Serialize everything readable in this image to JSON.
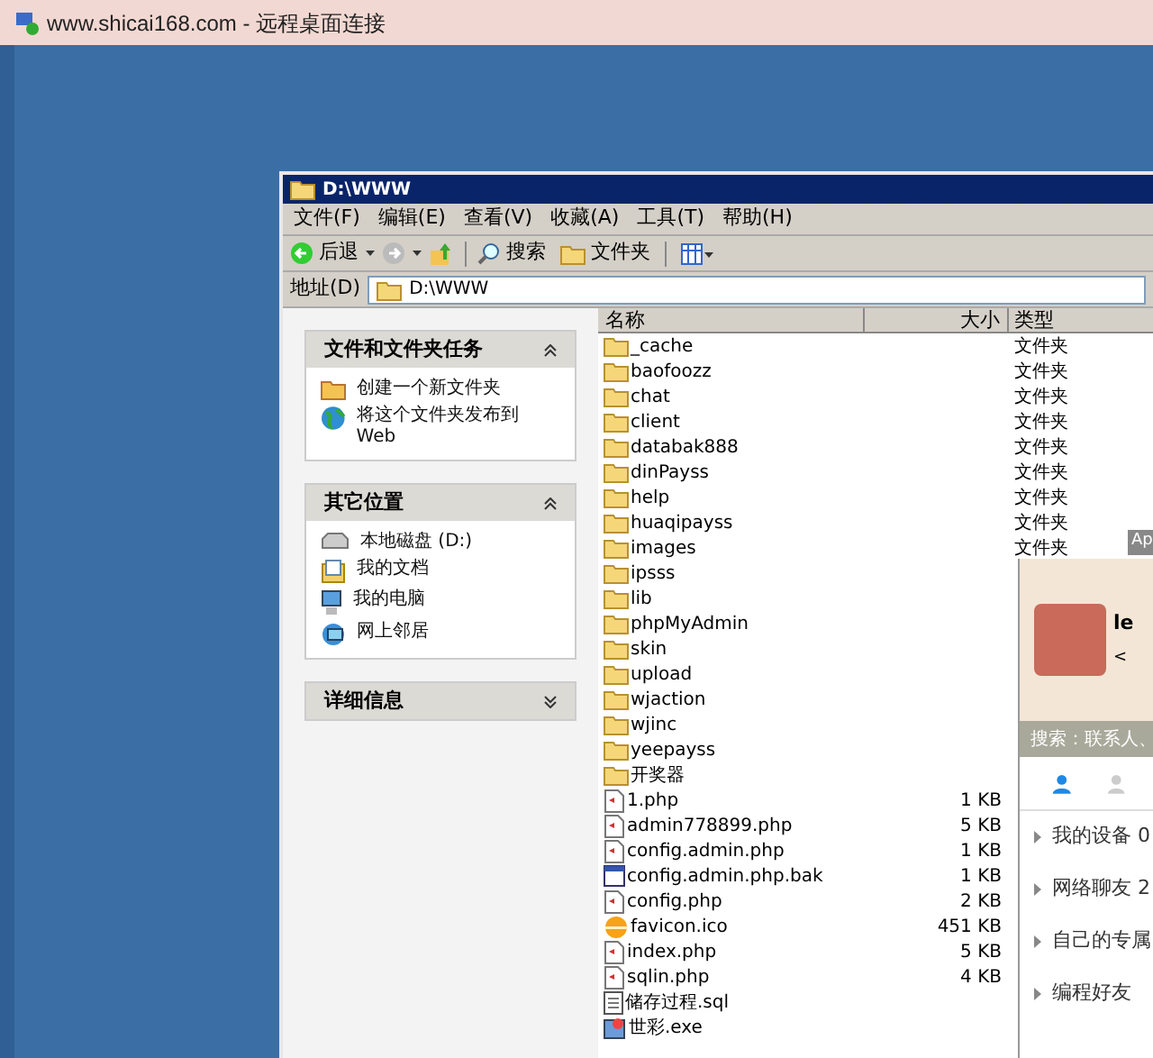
{
  "rdp_title": "www.shicai168.com - 远程桌面连接",
  "window": {
    "title": "D:\\WWW"
  },
  "menu": [
    "文件(F)",
    "编辑(E)",
    "查看(V)",
    "收藏(A)",
    "工具(T)",
    "帮助(H)"
  ],
  "toolbar": {
    "back": "后退",
    "search": "搜索",
    "folders": "文件夹"
  },
  "address": {
    "label": "地址(D)",
    "value": "D:\\WWW"
  },
  "panels": [
    {
      "title": "文件和文件夹任务",
      "expanded": true,
      "items": [
        {
          "kind": "new-folder",
          "label": "创建一个新文件夹"
        },
        {
          "kind": "globe",
          "label": "将这个文件夹发布到 Web"
        }
      ]
    },
    {
      "title": "其它位置",
      "expanded": true,
      "items": [
        {
          "kind": "drive",
          "label": "本地磁盘 (D:)"
        },
        {
          "kind": "documents",
          "label": "我的文档"
        },
        {
          "kind": "computer",
          "label": "我的电脑"
        },
        {
          "kind": "network",
          "label": "网上邻居"
        }
      ]
    },
    {
      "title": "详细信息",
      "expanded": false
    }
  ],
  "table": {
    "columns": [
      "名称",
      "大小",
      "类型"
    ],
    "rows": [
      {
        "kind": "folder",
        "name": "_cache",
        "type": "文件夹"
      },
      {
        "kind": "folder",
        "name": "baofoozz",
        "type": "文件夹"
      },
      {
        "kind": "folder",
        "name": "chat",
        "type": "文件夹"
      },
      {
        "kind": "folder",
        "name": "client",
        "type": "文件夹"
      },
      {
        "kind": "folder",
        "name": "databak888",
        "type": "文件夹"
      },
      {
        "kind": "folder",
        "name": "dinPayss",
        "type": "文件夹"
      },
      {
        "kind": "folder",
        "name": "help",
        "type": "文件夹"
      },
      {
        "kind": "folder",
        "name": "huaqipayss",
        "type": "文件夹"
      },
      {
        "kind": "folder",
        "name": "images",
        "type": "文件夹"
      },
      {
        "kind": "folder",
        "name": "ipsss"
      },
      {
        "kind": "folder",
        "name": "lib"
      },
      {
        "kind": "folder",
        "name": "phpMyAdmin"
      },
      {
        "kind": "folder",
        "name": "skin"
      },
      {
        "kind": "folder",
        "name": "upload"
      },
      {
        "kind": "folder",
        "name": "wjaction"
      },
      {
        "kind": "folder",
        "name": "wjinc"
      },
      {
        "kind": "folder",
        "name": "yeepayss"
      },
      {
        "kind": "folder",
        "name": "开奖器"
      },
      {
        "kind": "php",
        "name": "1.php",
        "size": "1 KB"
      },
      {
        "kind": "php",
        "name": "admin778899.php",
        "size": "5 KB"
      },
      {
        "kind": "php",
        "name": "config.admin.php",
        "size": "1 KB"
      },
      {
        "kind": "bak",
        "name": "config.admin.php.bak",
        "size": "1 KB"
      },
      {
        "kind": "php",
        "name": "config.php",
        "size": "2 KB"
      },
      {
        "kind": "ico",
        "name": "favicon.ico",
        "size": "451 KB"
      },
      {
        "kind": "php",
        "name": "index.php",
        "size": "5 KB"
      },
      {
        "kind": "php",
        "name": "sqlin.php",
        "size": "4 KB"
      },
      {
        "kind": "sql",
        "name": "储存过程.sql"
      },
      {
        "kind": "exe",
        "name": "世彩.exe"
      }
    ]
  },
  "qq_panel": {
    "tab": "Ap",
    "name": "le",
    "signature": "<",
    "search_placeholder": "搜索：联系人、",
    "groups": [
      "我的设备 0",
      "网络聊友 2",
      "自己的专属",
      "编程好友"
    ]
  }
}
